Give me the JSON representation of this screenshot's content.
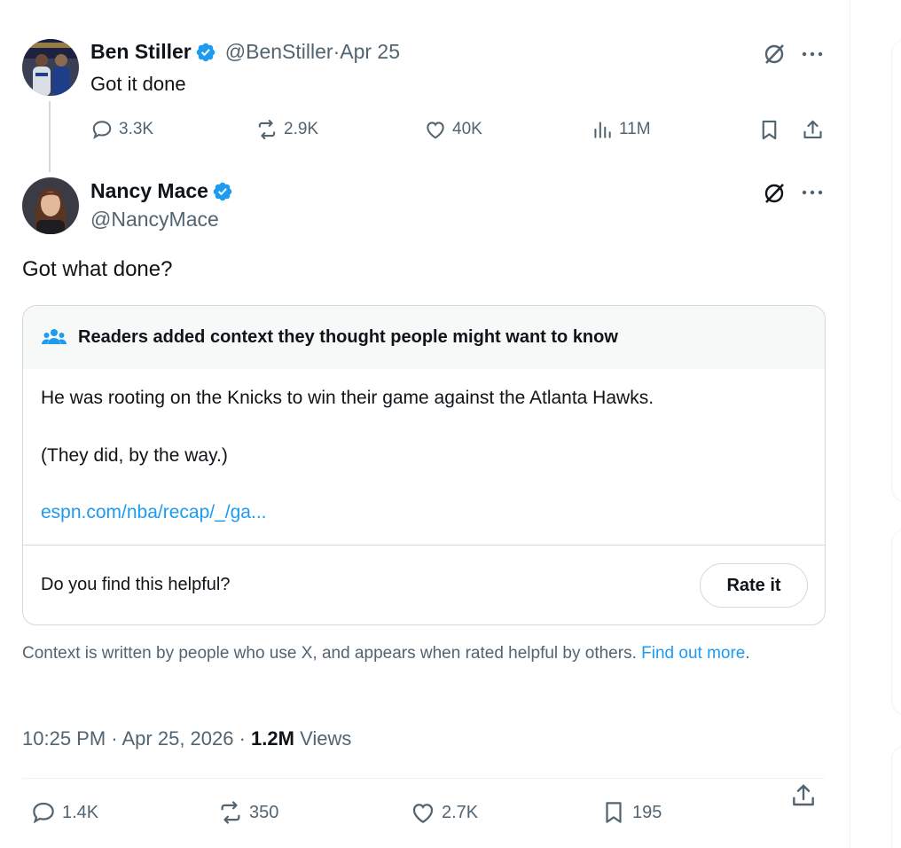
{
  "parent_tweet": {
    "author_name": "Ben Stiller",
    "handle": "@BenStiller",
    "separator": " · ",
    "date": "Apr 25",
    "text": "Got it done",
    "replies": "3.3K",
    "reposts": "2.9K",
    "likes": "40K",
    "views": "11M"
  },
  "main_tweet": {
    "author_name": "Nancy Mace",
    "handle": "@NancyMace",
    "text": "Got what done?",
    "community_note": {
      "header": "Readers added context they thought people might want to know",
      "line1": "He was rooting on the Knicks to win their game against the Atlanta Hawks.",
      "line2": "(They did, by the way.)",
      "link": "espn.com/nba/recap/_/ga...",
      "helpful_question": "Do you find this helpful?",
      "rate_label": "Rate it"
    },
    "disclaimer": "Context is written by people who use X, and appears when rated helpful by others.",
    "find_out_more": "Find out more",
    "disclaimer_end": ".",
    "timestamp": "10:25 PM · Apr 25, 2026 · ",
    "views_count": "1.2M",
    "views_label": " Views",
    "replies": "1.4K",
    "reposts": "350",
    "likes": "2.7K",
    "bookmarks": "195"
  },
  "colors": {
    "accent": "#1d9bf0",
    "text": "#0f1419",
    "secondary": "#536471",
    "border": "#cfd9de"
  }
}
